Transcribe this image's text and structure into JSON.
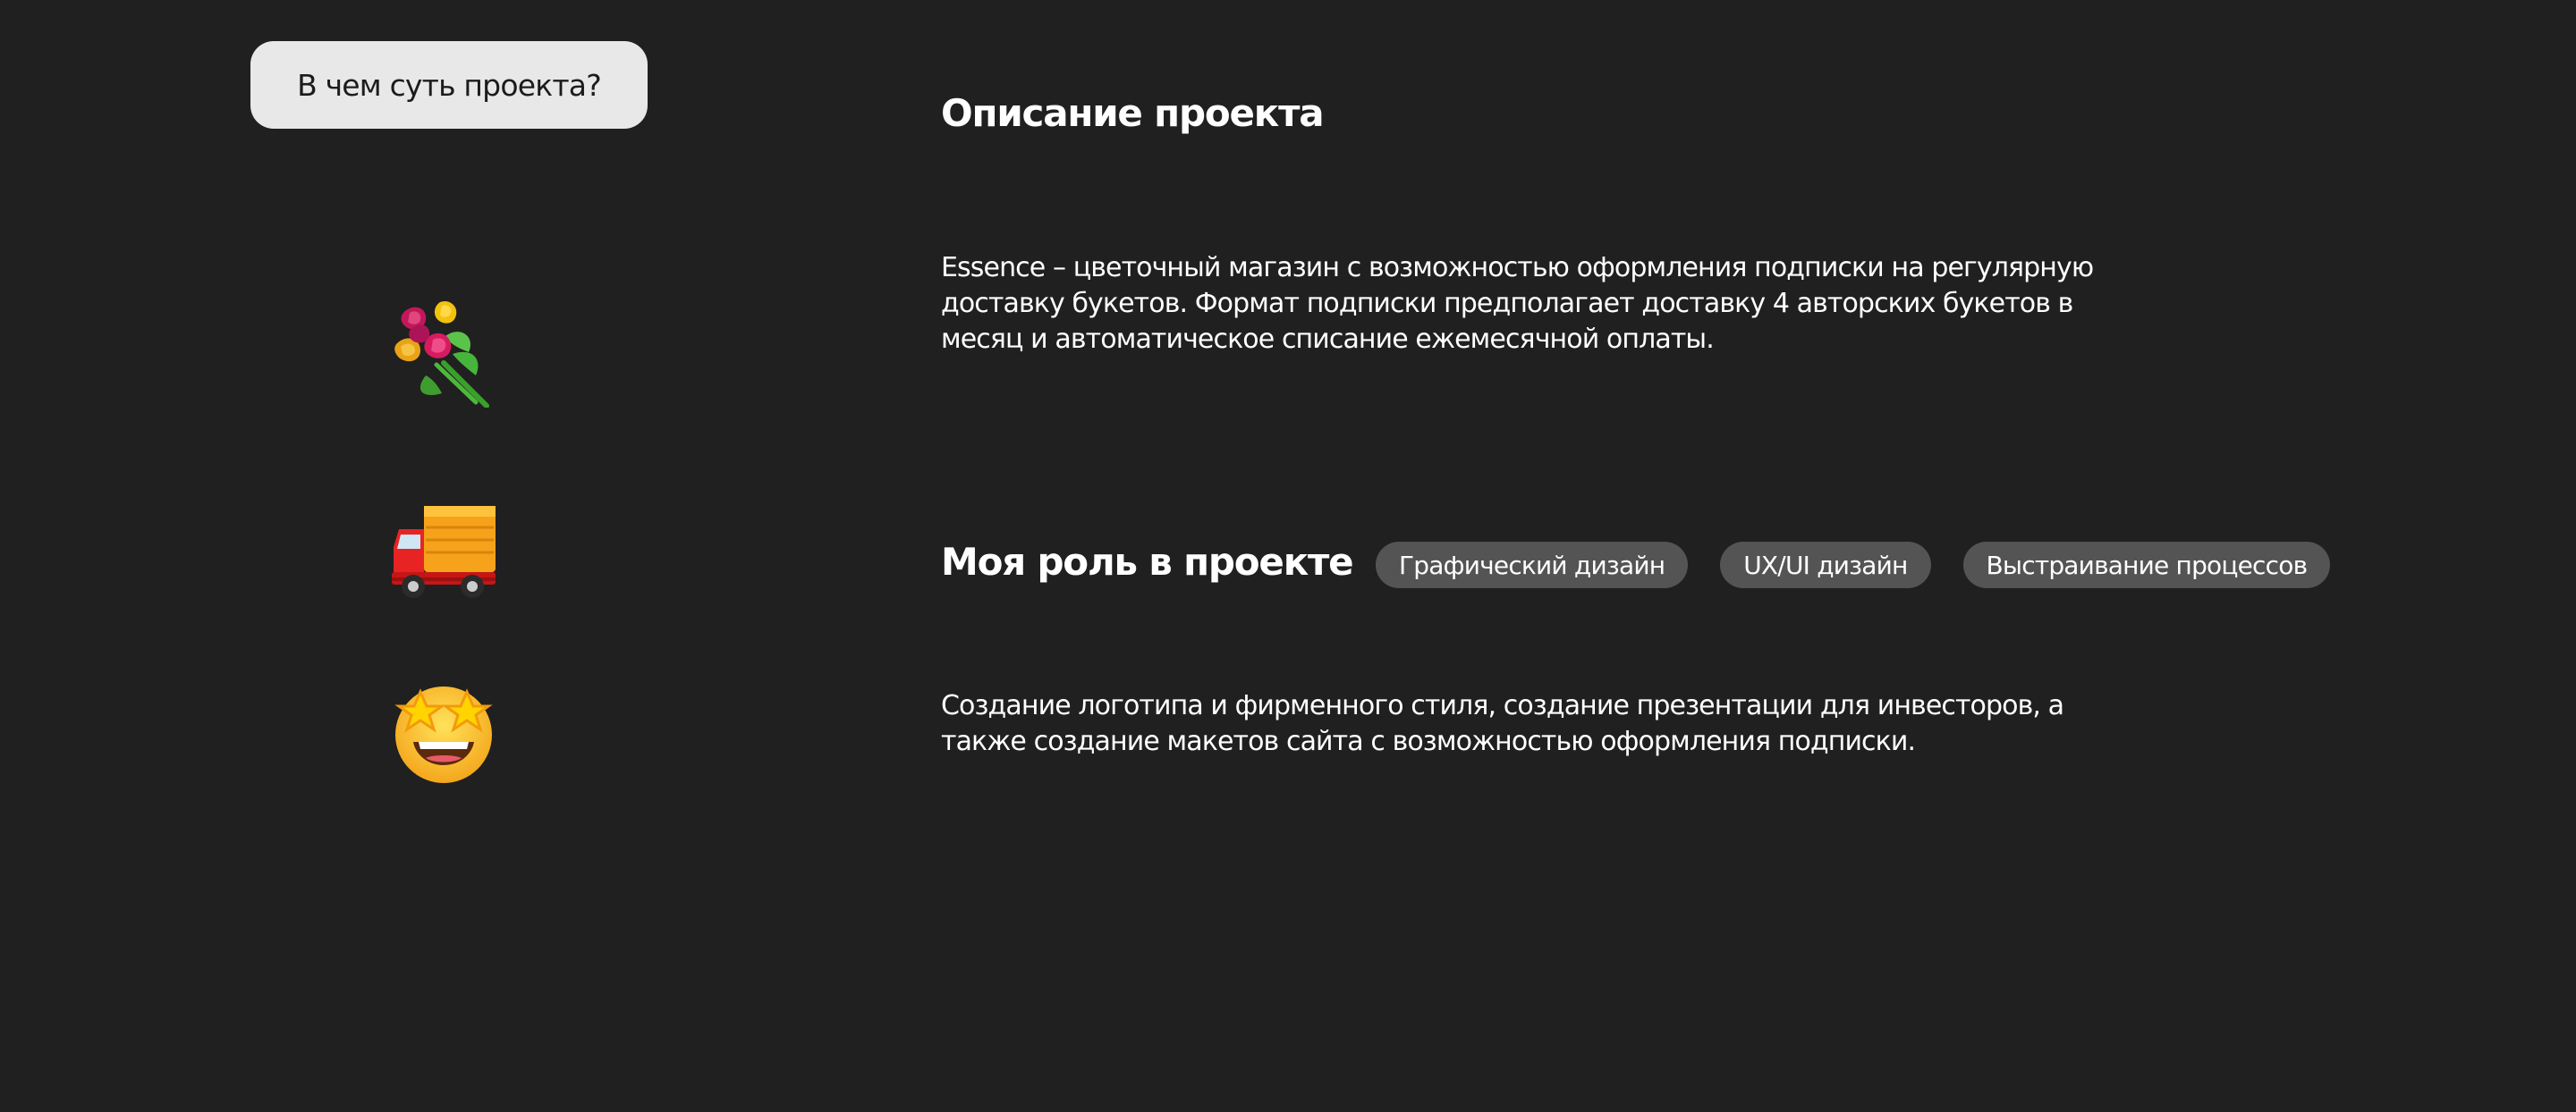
{
  "header": {
    "question_button": "В чем суть проекта?"
  },
  "description": {
    "title": "Описание проекта",
    "text": "Essence – цветочный магазин с возможностью оформления подписки на регулярную доставку букетов. Формат подписки предполагает доставку 4 авторских букетов в месяц и автоматическое списание ежемесячной оплаты."
  },
  "role": {
    "title": "Моя роль в проекте",
    "tags": [
      "Графический дизайн",
      "UX/UI дизайн",
      "Выстраивание процессов"
    ],
    "text": "Создание логотипа и фирменного стиля, создание презентации для инвесторов, а также создание макетов сайта с возможностью оформления подписки."
  },
  "icons": {
    "bouquet": "bouquet-emoji-icon",
    "truck": "delivery-truck-emoji-icon",
    "star": "star-struck-emoji-icon"
  },
  "colors": {
    "background": "#202020",
    "button": "#e8e8e8",
    "tag": "#545454",
    "text": "#ffffff"
  }
}
